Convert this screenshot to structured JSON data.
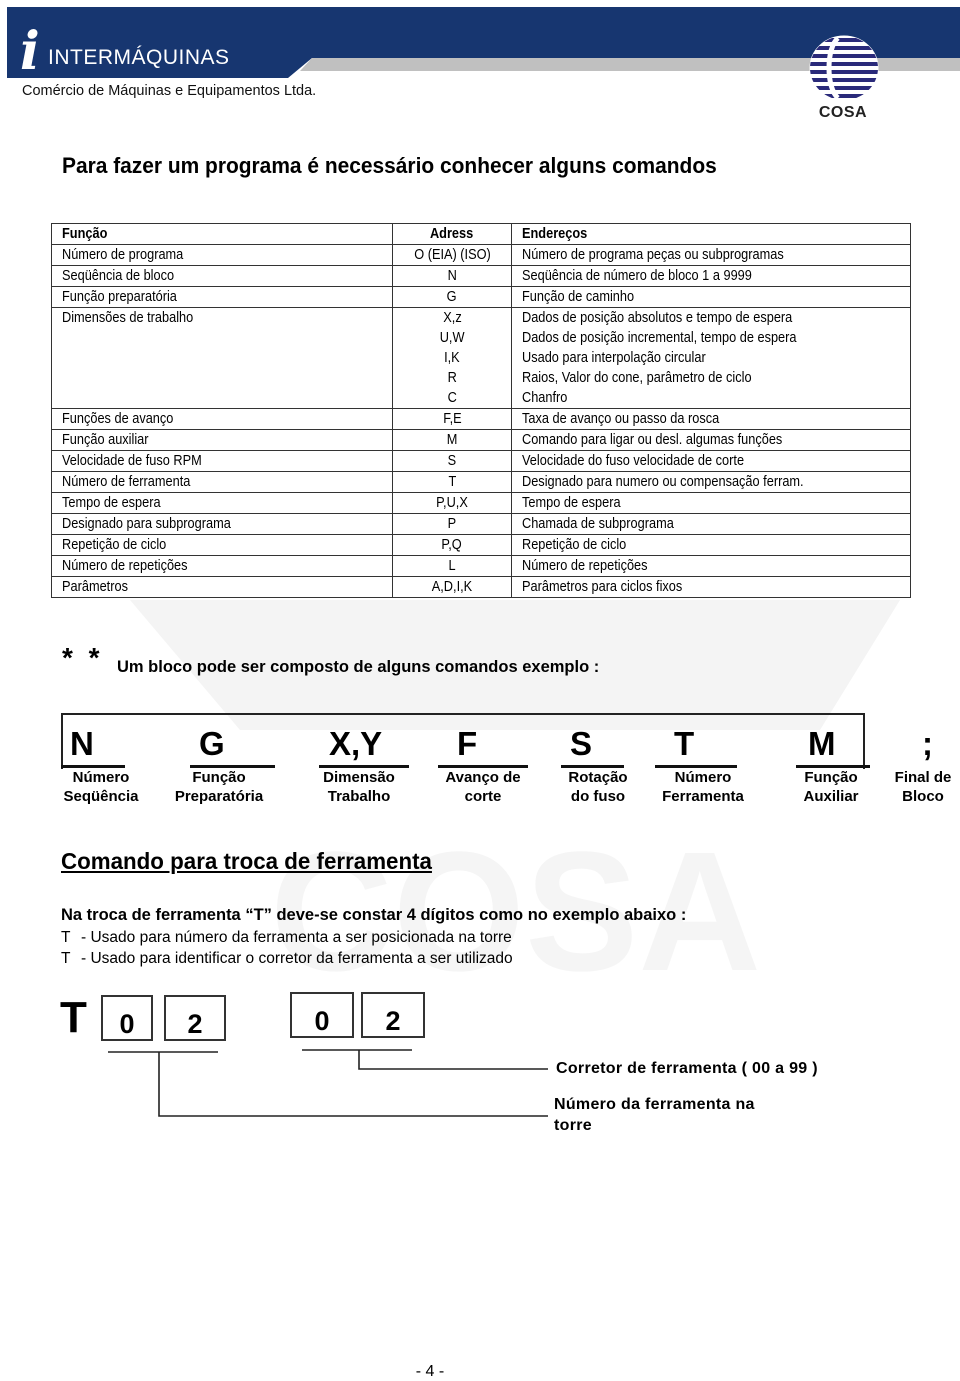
{
  "header": {
    "brand_initial": "i",
    "brand_name": "INTERMÁQUINAS",
    "brand_subtitle": "Comércio de Máquinas e Equipamentos Ltda.",
    "partner_logo": "COSA",
    "colors": {
      "banner": "#173670",
      "stripe": "#c0c0c0",
      "cosa_stripes": "#2a2a7a"
    }
  },
  "title": "Para fazer um programa é necessário conhecer alguns comandos",
  "table": {
    "headers": [
      "Função",
      "Adress",
      "Endereços"
    ],
    "rows": [
      {
        "funcao": "Número de programa",
        "adress": [
          "O (EIA) (ISO)"
        ],
        "enderecos": [
          "Número de programa peças ou subprogramas"
        ]
      },
      {
        "funcao": "Seqüência de bloco",
        "adress": [
          "N"
        ],
        "enderecos": [
          "Seqüência de número de bloco 1 a 9999"
        ]
      },
      {
        "funcao": "Função preparatória",
        "adress": [
          "G"
        ],
        "enderecos": [
          "Função de caminho"
        ]
      },
      {
        "funcao": "Dimensões de trabalho",
        "adress": [
          "X,z",
          "U,W",
          "I,K",
          "R",
          "C"
        ],
        "enderecos": [
          "Dados de posição absolutos e tempo de espera",
          "Dados de posição incremental, tempo de espera",
          "Usado para interpolação circular",
          "Raios, Valor do cone, parâmetro de ciclo",
          "Chanfro"
        ]
      },
      {
        "funcao": "Funções de avanço",
        "adress": [
          "F,E"
        ],
        "enderecos": [
          "Taxa de avanço ou passo da rosca"
        ]
      },
      {
        "funcao": "Função auxiliar",
        "adress": [
          "M"
        ],
        "enderecos": [
          "Comando para ligar ou desl. algumas funções"
        ]
      },
      {
        "funcao": "Velocidade de fuso RPM",
        "adress": [
          "S"
        ],
        "enderecos": [
          "Velocidade do fuso velocidade de corte"
        ]
      },
      {
        "funcao": "Número de ferramenta",
        "adress": [
          "T"
        ],
        "enderecos": [
          "Designado para numero ou compensação ferram."
        ]
      },
      {
        "funcao": "Tempo de espera",
        "adress": [
          "P,U,X"
        ],
        "enderecos": [
          "Tempo de espera"
        ]
      },
      {
        "funcao": "Designado para subprograma",
        "adress": [
          "P"
        ],
        "enderecos": [
          "Chamada de subprograma"
        ]
      },
      {
        "funcao": "Repetição de ciclo",
        "adress": [
          "P,Q"
        ],
        "enderecos": [
          "Repetição de ciclo"
        ]
      },
      {
        "funcao": "Número de repetições",
        "adress": [
          "L"
        ],
        "enderecos": [
          "Número de repetições"
        ]
      },
      {
        "funcao": "Parâmetros",
        "adress": [
          "A,D,I,K"
        ],
        "enderecos": [
          "Parâmetros para ciclos fixos"
        ]
      }
    ]
  },
  "block": {
    "marker": "* *",
    "intro": "Um bloco pode ser composto  de alguns comandos  exemplo :",
    "items": [
      {
        "code": "N",
        "label1": "Número",
        "label2": "Seqüência"
      },
      {
        "code": "G",
        "label1": "Função",
        "label2": "Preparatória"
      },
      {
        "code": "X,Y",
        "label1": "Dimensão",
        "label2": "Trabalho"
      },
      {
        "code": "F",
        "label1": "Avanço de",
        "label2": "corte"
      },
      {
        "code": "S",
        "label1": "Rotação",
        "label2": "do fuso"
      },
      {
        "code": "T",
        "label1": "Número",
        "label2": "Ferramenta"
      },
      {
        "code": "M",
        "label1": "Função",
        "label2": "Auxiliar"
      },
      {
        "code": ";",
        "label1": "Final de",
        "label2": "Bloco"
      }
    ]
  },
  "tool_change": {
    "title": "Comando para troca de ferramenta",
    "intro": "Na troca de ferramenta  “T” deve-se constar 4 dígitos como no exemplo abaixo :",
    "lines": [
      {
        "letter": "T",
        "text": "- Usado para número da ferramenta a ser posicionada na torre"
      },
      {
        "letter": "T",
        "text": "- Usado para identificar o corretor da ferramenta a ser utilizado"
      }
    ],
    "example": {
      "prefix": "T",
      "digits": [
        "0",
        "2",
        "0",
        "2"
      ],
      "corrector_label": "Corretor de ferramenta ( 00 a 99 )",
      "tool_number_label_1": "Número da ferramenta na",
      "tool_number_label_2": "torre"
    }
  },
  "footer": {
    "page_number": "- 4 -"
  }
}
